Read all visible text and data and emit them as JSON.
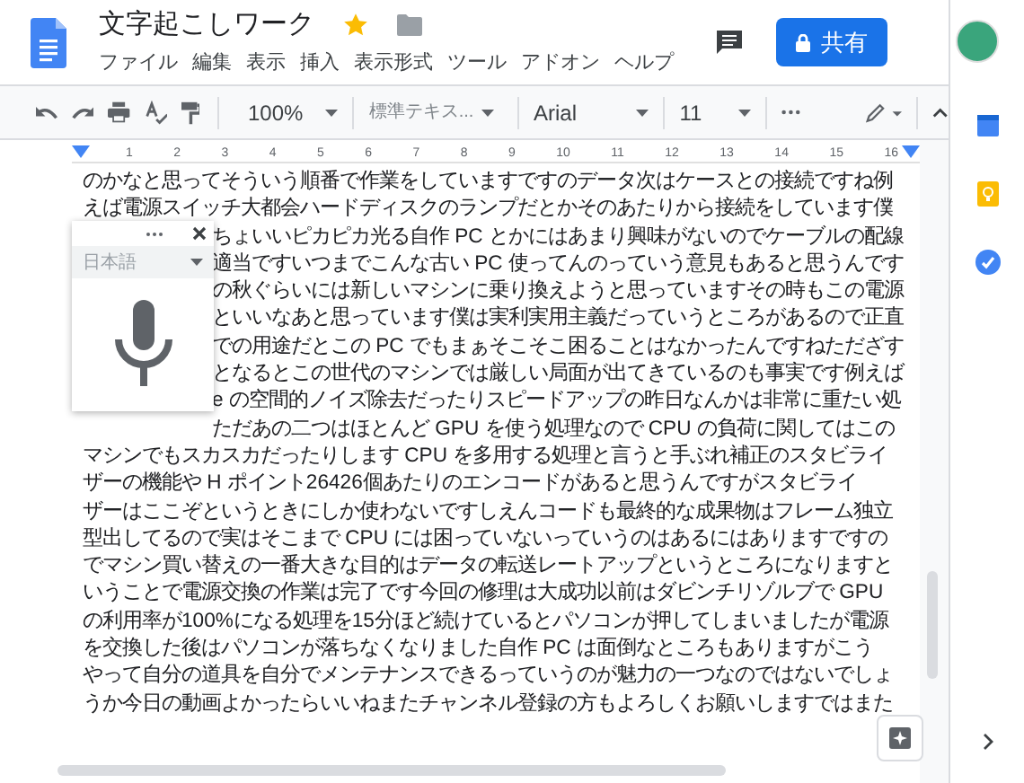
{
  "document": {
    "title": "文字起こしワーク",
    "starred": true
  },
  "menu": [
    "ファイル",
    "編集",
    "表示",
    "挿入",
    "表示形式",
    "ツール",
    "アドオン",
    "ヘルプ"
  ],
  "share_button": {
    "label": "共有"
  },
  "toolbar": {
    "zoom": "100%",
    "style": "標準テキス...",
    "font": "Arial",
    "size": "11"
  },
  "ruler": [
    "1",
    "2",
    "3",
    "4",
    "5",
    "6",
    "7",
    "8",
    "9",
    "10",
    "11",
    "12",
    "13",
    "14",
    "15",
    "16"
  ],
  "body_lines": [
    {
      "text": "のかなと思ってそういう順番で作業をしていますですのデータ次はケースとの接続ですね例",
      "partly_hidden": false
    },
    {
      "text": "えば電源スイッチ大都会ハードディスクのランプだとかそのあたりから接続をしています僕",
      "partly_hidden": false
    },
    {
      "text": "ちょいいピカピカ光る自作 PC とかにはあまり興味がないのでケーブルの配線",
      "partly_hidden": true
    },
    {
      "text": "適当ですいつまでこんな古い PC 使ってんのっていう意見もあると思うんです",
      "partly_hidden": true
    },
    {
      "text": "の秋ぐらいには新しいマシンに乗り換えようと思っていますその時もこの電源",
      "partly_hidden": true
    },
    {
      "text": "といいなあと思っています僕は実利実用主義だっていうところがあるので正直",
      "partly_hidden": true
    },
    {
      "text": "での用途だとこの PC でもまぁそこそこ困ることはなかったんですねただざす",
      "partly_hidden": true
    },
    {
      "text": "となるとこの世代のマシンでは厳しい局面が出てきているのも事実です例えば",
      "partly_hidden": true
    },
    {
      "text": "e の空間的ノイズ除去だったりスピードアップの昨日なんかは非常に重たい処",
      "partly_hidden": true
    },
    {
      "text": "ただあの二つはほとんど GPU を使う処理なので CPU の負荷に関してはこの",
      "partly_hidden": true
    },
    {
      "text": "マシンでもスカスカだったりします CPU を多用する処理と言うと手ぶれ補正のスタビライ",
      "partly_hidden": false
    },
    {
      "text": "ザーの機能や H ポイント26426個あたりのエンコードがあると思うんですがスタビライ",
      "partly_hidden": false
    },
    {
      "text": "ザーはここぞというときにしか使わないですしえんコードも最終的な成果物はフレーム独立",
      "partly_hidden": false
    },
    {
      "text": "型出してるので実はそこまで CPU には困っていないっていうのはあるにはありますですの",
      "partly_hidden": false
    },
    {
      "text": "でマシン買い替えの一番大きな目的はデータの転送レートアップというところになりますと",
      "partly_hidden": false
    },
    {
      "text": "いうことで電源交換の作業は完了です今回の修理は大成功以前はダビンチリゾルブで GPU",
      "partly_hidden": false
    },
    {
      "text": "の利用率が100%になる処理を15分ほど続けているとパソコンが押してしまいましたが電源",
      "partly_hidden": false
    },
    {
      "text": "を交換した後はパソコンが落ちなくなりました自作 PC は面倒なところもありますがこう",
      "partly_hidden": false
    },
    {
      "text": "やって自分の道具を自分でメンテナンスできるっていうのが魅力の一つなのではないでしょ",
      "partly_hidden": false
    },
    {
      "text": "うか今日の動画よかったらいいねまたチャンネル登録の方もよろしくお願いしますではまた",
      "partly_hidden": false
    }
  ],
  "voice_typing": {
    "language": "日本語"
  }
}
